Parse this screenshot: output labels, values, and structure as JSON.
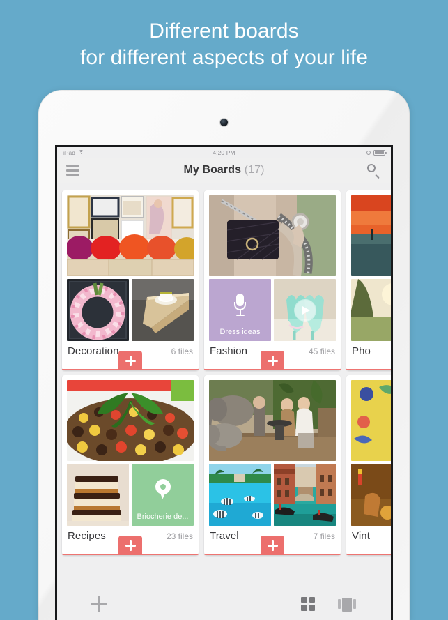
{
  "headline": {
    "line1": "Different boards",
    "line2": "for different aspects of your life"
  },
  "colors": {
    "background": "#65aaca",
    "accent_red": "#ec6f6d",
    "voice_tile": "#bba6d0",
    "place_tile": "#91ce9a"
  },
  "status_bar": {
    "carrier": "iPad",
    "wifi_icon": "wifi-icon",
    "time": "4:20 PM",
    "lock_icon": "rotation-lock-icon",
    "battery_icon": "battery-icon"
  },
  "navbar": {
    "menu_icon": "hamburger-menu-icon",
    "title": "My Boards",
    "count": "(17)",
    "search_icon": "search-icon"
  },
  "boards": [
    {
      "name": "Decoration",
      "count": "6 files",
      "add_label": "+",
      "hero": "gallery-wall-with-colorful-floral-sofa",
      "tiles": [
        {
          "kind": "photo",
          "desc": "pink-tulip-wreath-on-dark-door"
        },
        {
          "kind": "photo",
          "desc": "teacup-on-wooden-sofa-tray"
        }
      ]
    },
    {
      "name": "Fashion",
      "count": "45 files",
      "add_label": "+",
      "hero": "quilted-black-handbag-and-tweed-jacket",
      "tiles": [
        {
          "kind": "voice",
          "label": "Dress ideas",
          "icon": "microphone-icon"
        },
        {
          "kind": "video",
          "desc": "mint-bow-high-heels",
          "icon": "play-icon"
        }
      ]
    },
    {
      "name": "Pho",
      "count": "",
      "add_label": "+",
      "hero": "orange-sunset-over-lake",
      "tiles": [
        {
          "kind": "photo",
          "desc": "sunlit-trees-in-field"
        }
      ]
    },
    {
      "name": "Recipes",
      "count": "23 files",
      "add_label": "+",
      "hero": "black-bean-and-corn-salad-with-basil",
      "tiles": [
        {
          "kind": "photo",
          "desc": "chocolate-caramel-dessert-bars"
        },
        {
          "kind": "place",
          "label": "Briocherie de...",
          "icon": "map-pin-icon"
        }
      ]
    },
    {
      "name": "Travel",
      "count": "7 files",
      "add_label": "+",
      "hero": "couple-dining-beside-elephants",
      "tiles": [
        {
          "kind": "photo",
          "desc": "tropical-lagoon-with-striped-fish"
        },
        {
          "kind": "photo",
          "desc": "venice-canal-with-gondolas"
        }
      ]
    },
    {
      "name": "Vint",
      "count": "",
      "add_label": "+",
      "hero": "yellow-vintage-pattern-artwork",
      "tiles": [
        {
          "kind": "photo",
          "desc": "brown-vintage-poster-art"
        }
      ]
    }
  ],
  "toolbar": {
    "add_icon": "plus-icon",
    "grid_view_icon": "grid-view-icon",
    "carousel_view_icon": "carousel-view-icon"
  }
}
